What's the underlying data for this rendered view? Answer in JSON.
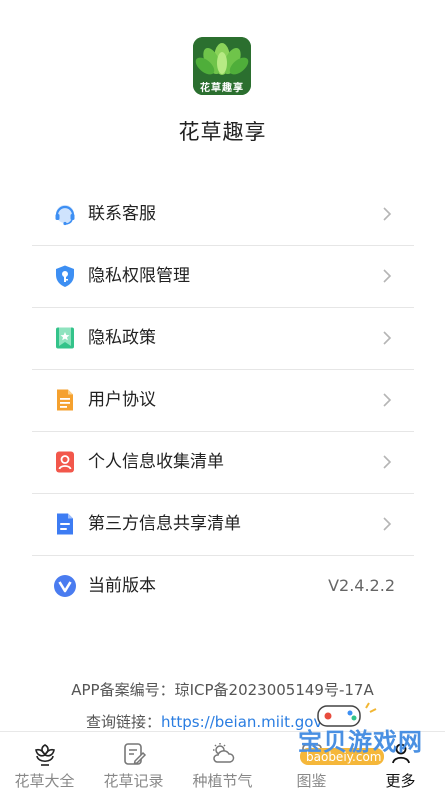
{
  "app": {
    "name": "花草趣享",
    "logo_text": "花草趣享"
  },
  "menu": [
    {
      "icon": "headset-icon",
      "label": "联系客服",
      "color": "#3d8ff3"
    },
    {
      "icon": "shield-key-icon",
      "label": "隐私权限管理",
      "color": "#3d8ff3"
    },
    {
      "icon": "bookmark-star-icon",
      "label": "隐私政策",
      "color": "#33c38a"
    },
    {
      "icon": "document-icon",
      "label": "用户协议",
      "color": "#f5a12f"
    },
    {
      "icon": "person-card-icon",
      "label": "个人信息收集清单",
      "color": "#f2574b"
    },
    {
      "icon": "list-document-icon",
      "label": "第三方信息共享清单",
      "color": "#3d7cf3"
    },
    {
      "icon": "version-v-icon",
      "label": "当前版本",
      "value": "V2.4.2.2",
      "color": "#4a7cf0"
    }
  ],
  "footer": {
    "icp": "APP备案编号：琼ICP备2023005149号-17A",
    "query_label": "查询链接：",
    "query_link": "https://beian.miit.gov"
  },
  "tabs": [
    {
      "label": "花草大全",
      "icon": "flower-icon"
    },
    {
      "label": "花草记录",
      "icon": "notebook-edit-icon"
    },
    {
      "label": "种植节气",
      "icon": "weather-cloud-icon"
    },
    {
      "label": "图鉴",
      "icon": "catalog-icon"
    },
    {
      "label": "更多",
      "icon": "user-icon",
      "active": true
    }
  ],
  "watermark": {
    "title": "宝贝游戏网",
    "domain": "baobeiy.com"
  },
  "colors": {
    "link": "#2a7de1",
    "logo_bg": "#2a7a32",
    "divider": "#e6e6e6"
  }
}
